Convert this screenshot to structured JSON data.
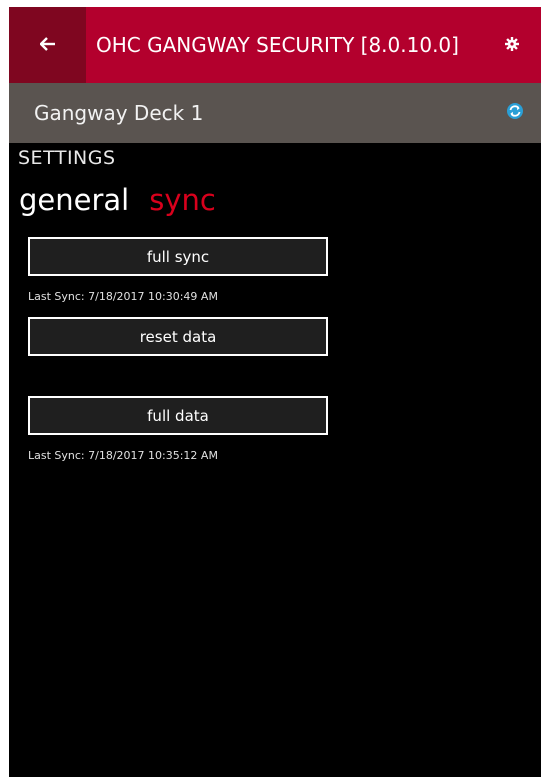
{
  "header": {
    "title": "OHC GANGWAY SECURITY [8.0.10.0]",
    "back_icon": "back-arrow-icon",
    "settings_icon": "gear-icon",
    "background": "#b3002d",
    "back_background": "#7f0620"
  },
  "subheader": {
    "title": "Gangway Deck 1",
    "refresh_icon": "sync-icon",
    "background": "#5a5450",
    "icon_color": "#2a9fd6"
  },
  "page": {
    "section_title": "SETTINGS",
    "tabs": [
      {
        "label": "general",
        "active": false
      },
      {
        "label": "sync",
        "active": true
      }
    ],
    "accent": "#d8001c"
  },
  "actions": {
    "full_sync_label": "full sync",
    "full_sync_last": "Last Sync: 7/18/2017 10:30:49 AM",
    "reset_data_label": "reset data",
    "full_data_label": "full data",
    "full_data_last": "Last Sync: 7/18/2017 10:35:12 AM"
  }
}
